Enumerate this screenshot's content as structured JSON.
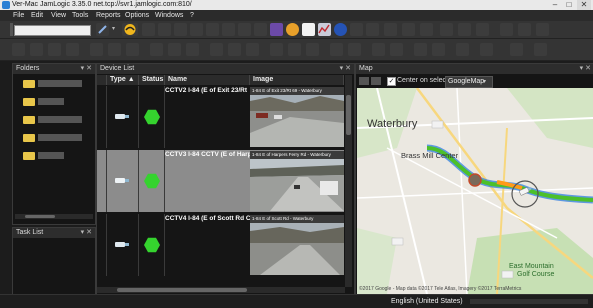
{
  "window": {
    "title": "Ver-Mac JamLogic 3.35.0 net.tcp://svr1.jamlogic.com:810/",
    "min": "–",
    "max": "□",
    "close": "✕"
  },
  "menu": [
    "File",
    "Edit",
    "View",
    "Tools",
    "Reports",
    "Options",
    "Windows",
    "?"
  ],
  "panels": {
    "folders": {
      "title": "Folders"
    },
    "task_list": {
      "title": "Task List"
    },
    "device_list": {
      "title": "Device List"
    },
    "map": {
      "title": "Map"
    }
  },
  "device_list": {
    "columns": [
      "Type",
      "Status",
      "Name",
      "Image"
    ],
    "sort_indicator": "▲",
    "rows": [
      {
        "name": "CCTV2 I-84 (E of Exit 23/Rt",
        "status_color": "#35d32e",
        "caption": "1-84 E of Exit 23/Rt 69 - Waterbury"
      },
      {
        "name": "CCTV3 I-84 CCTV (E of Harp",
        "status_color": "#35d32e",
        "caption": "1-84 E of Harpers Ferry Rd - Waterbury"
      },
      {
        "name": "CCTV4 I-84 (E of Scott Rd C",
        "status_color": "#35d32e",
        "caption": "1-84 E of Scott Rd - Waterbury"
      }
    ]
  },
  "map": {
    "center_on_select_label": "Center on select",
    "center_on_select_checked": true,
    "provider": "GoogleMap",
    "labels": {
      "waterbury": "Waterbury",
      "brass_mill": "Brass Mill Center",
      "east_mountain": "East Mountain",
      "golf": "Golf Course"
    },
    "attribution": "©2017 Google - Map data ©2017 Tele Atlas, Imagery ©2017 TerraMetrics"
  },
  "status": {
    "language": "English (United States)"
  },
  "colors": {
    "accent_green": "#35d32e",
    "folder": "#e8c64a",
    "selected_row": "#8c8c8c"
  }
}
